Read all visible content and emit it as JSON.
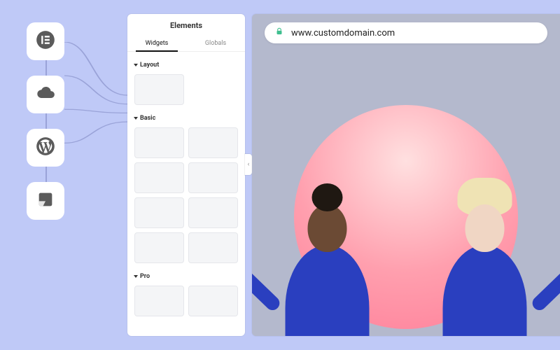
{
  "rail": {
    "items": [
      "elementor",
      "cloud",
      "wordpress",
      "templates"
    ]
  },
  "panel": {
    "title": "Elements",
    "tabs": [
      {
        "label": "Widgets",
        "active": true
      },
      {
        "label": "Globals",
        "active": false
      }
    ],
    "sections": {
      "layout": "Layout",
      "basic": "Basic",
      "pro": "Pro"
    }
  },
  "preview": {
    "url": "www.customdomain.com"
  }
}
